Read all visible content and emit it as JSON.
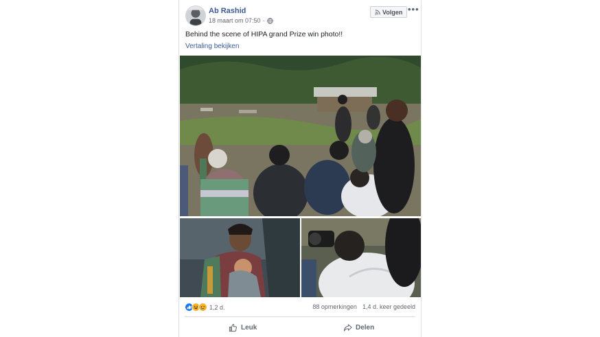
{
  "post": {
    "author": "Ab Rashid",
    "date": "18 maart om 07:50",
    "separator": "·",
    "privacy_icon": "globe-icon",
    "follow_label": "Volgen",
    "follow_icon": "rss-icon",
    "more_icon": "more-options-icon",
    "more_label": "•••",
    "text": "Behind the scene of HIPA grand Prize win photo!!",
    "translate_link": "Vertaling bekijken"
  },
  "photos": [
    {
      "name": "photographers-crowd",
      "icon": "photo"
    },
    {
      "name": "mother-and-child",
      "icon": "photo"
    },
    {
      "name": "photographer-closeup",
      "icon": "photo"
    }
  ],
  "reactions": {
    "icons": [
      "like-reaction-icon",
      "haha-reaction-icon",
      "sad-reaction-icon"
    ],
    "count": "1,2 d."
  },
  "stats": {
    "comments": "88 opmerkingen",
    "shares": "1,4 d. keer gedeeld"
  },
  "actions": {
    "like_label": "Leuk",
    "share_label": "Delen"
  },
  "colors": {
    "link": "#385898",
    "like_blue": "#1877f2",
    "haha_yellow": "#f7b125"
  }
}
